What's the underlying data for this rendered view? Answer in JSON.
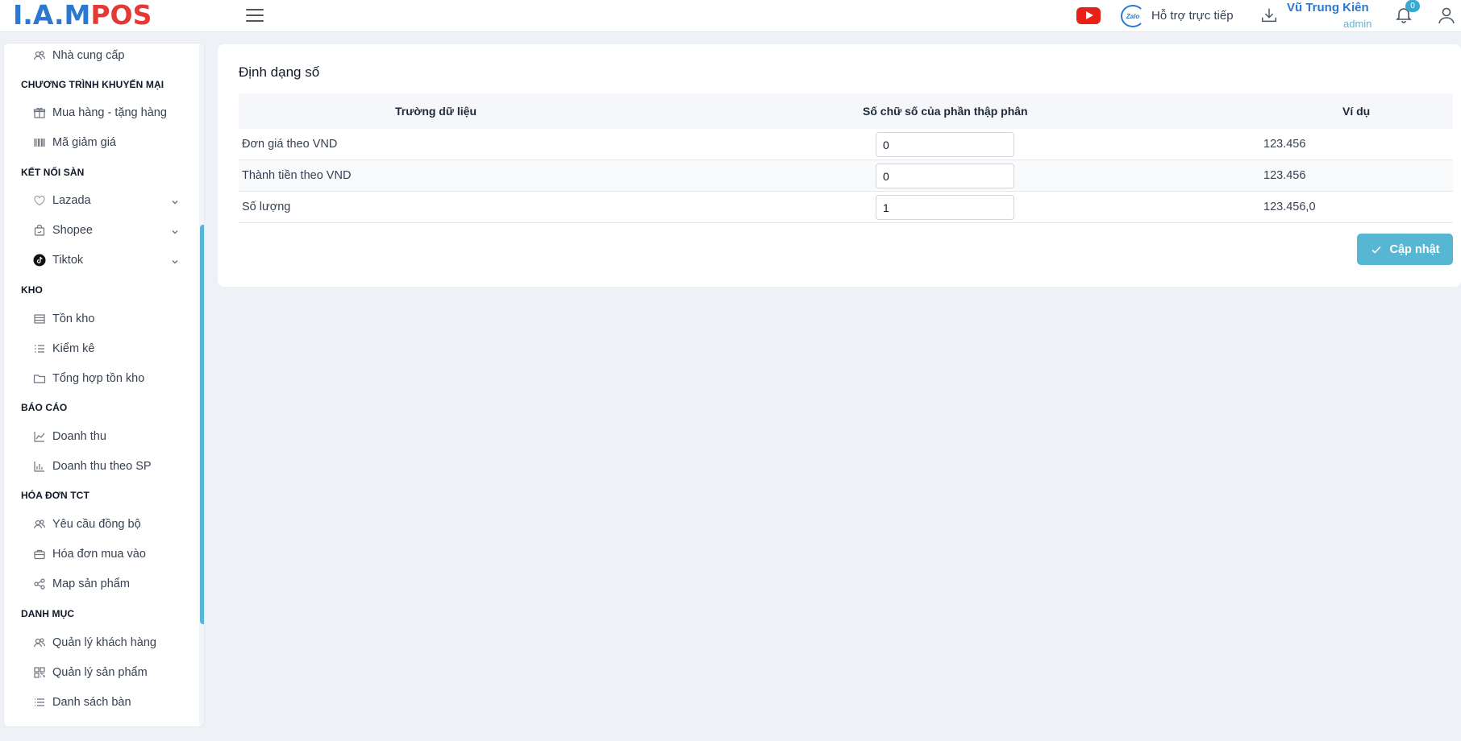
{
  "header": {
    "logo_part1": "I.A.M",
    "logo_part2": "POS",
    "support_label": "Hỗ trợ trực tiếp",
    "zalo_label": "Zalo",
    "user_name": "Vũ Trung Kiên",
    "user_role": "admin",
    "notification_count": "0"
  },
  "sidebar": {
    "items": [
      {
        "label": "Nhà cung cấp",
        "icon": "users-icon"
      },
      {
        "section": "CHƯƠNG TRÌNH KHUYẾN MẠI"
      },
      {
        "label": "Mua hàng - tặng hàng",
        "icon": "gift-icon"
      },
      {
        "label": "Mã giảm giá",
        "icon": "barcode-icon"
      },
      {
        "section": "KẾT NỐI SÀN"
      },
      {
        "label": "Lazada",
        "icon": "heart-icon"
      },
      {
        "label": "Shopee",
        "icon": "bag-icon"
      },
      {
        "label": "Tiktok",
        "icon": "tiktok-icon"
      },
      {
        "section": "KHO"
      },
      {
        "label": "Tồn kho",
        "icon": "list-icon"
      },
      {
        "label": "Kiểm kê",
        "icon": "checklist-icon"
      },
      {
        "label": "Tổng hợp tồn kho",
        "icon": "folder-icon"
      },
      {
        "section": "BÁO CÁO"
      },
      {
        "label": "Doanh thu",
        "icon": "line-chart-icon"
      },
      {
        "label": "Doanh thu theo SP",
        "icon": "bar-chart-icon"
      },
      {
        "section": "HÓA ĐƠN TCT"
      },
      {
        "label": "Yêu cầu đồng bộ",
        "icon": "users-icon"
      },
      {
        "label": "Hóa đơn mua vào",
        "icon": "briefcase-icon"
      },
      {
        "label": "Map sản phẩm",
        "icon": "share-icon"
      },
      {
        "section": "DANH MỤC"
      },
      {
        "label": "Quản lý khách hàng",
        "icon": "users-icon"
      },
      {
        "label": "Quản lý sản phẩm",
        "icon": "qr-icon"
      },
      {
        "label": "Danh sách bàn",
        "icon": "list-icon"
      }
    ]
  },
  "main": {
    "title": "Định dạng số",
    "table": {
      "headers": [
        "Trường dữ liệu",
        "Số chữ số của phần thập phân",
        "Ví dụ"
      ],
      "rows": [
        {
          "field": "Đơn giá theo VND",
          "decimals": "0",
          "example": "123.456"
        },
        {
          "field": "Thành tiền theo VND",
          "decimals": "0",
          "example": "123.456"
        },
        {
          "field": "Số lượng",
          "decimals": "1",
          "example": "123.456,0"
        }
      ]
    },
    "update_label": "Cập nhật"
  },
  "colors": {
    "accent": "#57b6d2",
    "brand_blue": "#2b78d0",
    "brand_red": "#e53935",
    "youtube_red": "#e62117"
  }
}
